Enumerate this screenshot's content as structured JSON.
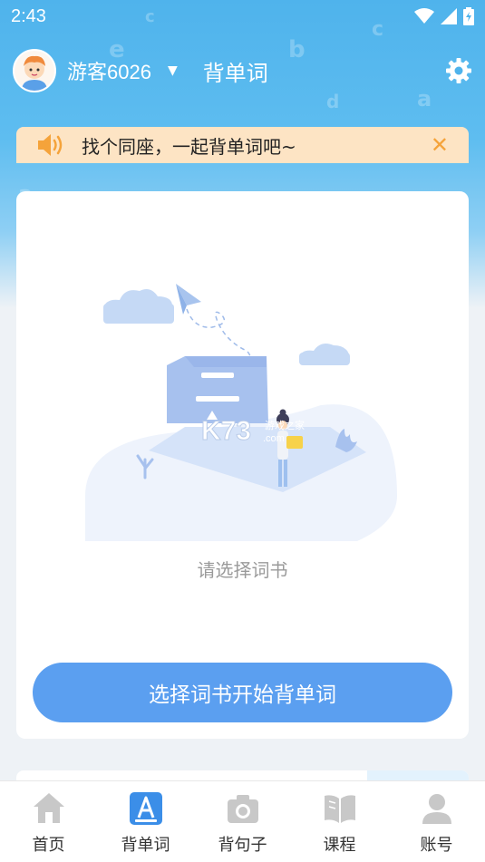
{
  "status_bar": {
    "time": "2:43"
  },
  "header": {
    "username": "游客6026",
    "dropdown_symbol": "▼",
    "title": "背单词"
  },
  "notice": {
    "text": "找个同座，一起背单词吧~",
    "close_symbol": "✕"
  },
  "card": {
    "empty_text": "请选择词书",
    "start_button": "选择词书开始背单词",
    "watermark_main": "K73",
    "watermark_sub": "游戏之家",
    "watermark_domain": ".com"
  },
  "tabbar": {
    "items": [
      {
        "label": "首页",
        "icon": "home-icon",
        "active": false
      },
      {
        "label": "背单词",
        "icon": "word-book-icon",
        "active": true
      },
      {
        "label": "背句子",
        "icon": "camera-icon",
        "active": false
      },
      {
        "label": "课程",
        "icon": "open-book-icon",
        "active": false
      },
      {
        "label": "账号",
        "icon": "user-icon",
        "active": false
      }
    ]
  },
  "colors": {
    "header_gradient_top": "#4fb3ec",
    "notice_bg": "#fde4c4",
    "notice_accent": "#f5a33a",
    "primary_button": "#5b9ff0",
    "active_tab": "#3b8ee8",
    "inactive_tab": "#c8c8c8"
  }
}
